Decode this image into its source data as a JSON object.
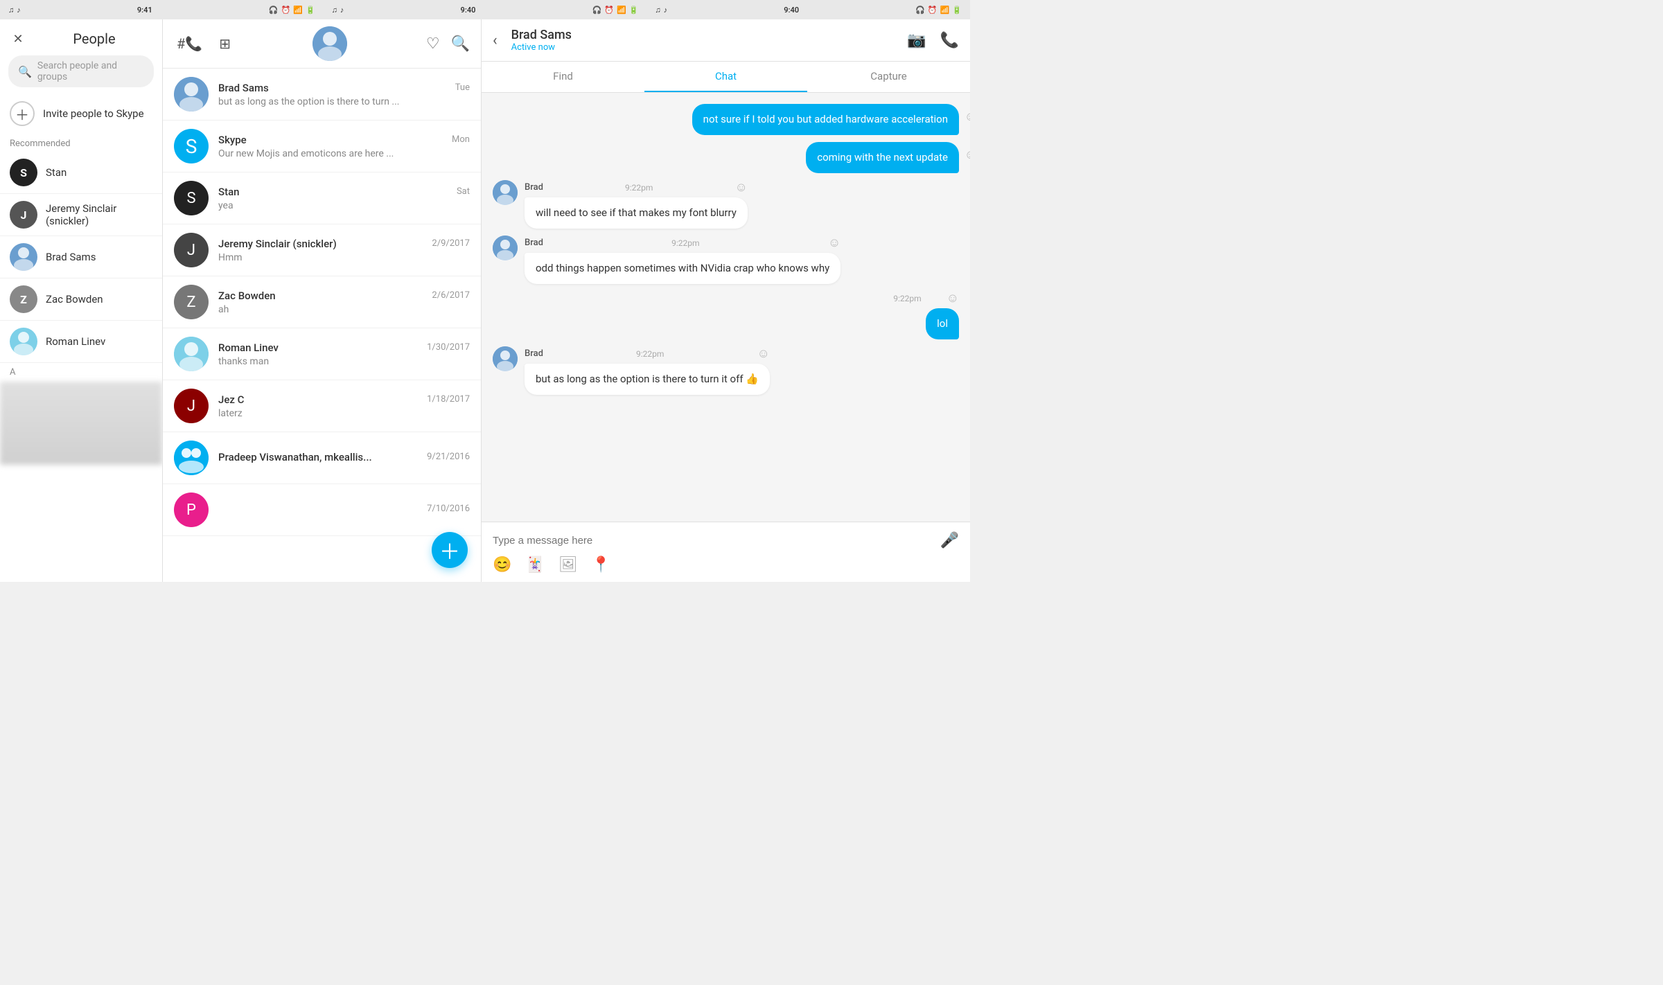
{
  "statusBars": [
    {
      "id": "left",
      "time": "9:41",
      "icons": [
        "spotify",
        "music"
      ]
    },
    {
      "id": "middle",
      "time": "9:40",
      "icons": [
        "spotify",
        "music"
      ]
    },
    {
      "id": "right",
      "time": "9:40",
      "icons": [
        "spotify",
        "music"
      ]
    }
  ],
  "leftPanel": {
    "title": "People",
    "searchPlaceholder": "Search people and groups",
    "inviteLabel": "Invite people to Skype",
    "sectionLabel": "Recommended",
    "contacts": [
      {
        "id": "stan",
        "name": "Stan"
      },
      {
        "id": "jeremy",
        "name": "Jeremy Sinclair (snickler)"
      },
      {
        "id": "brad",
        "name": "Brad Sams"
      },
      {
        "id": "zac",
        "name": "Zac Bowden"
      },
      {
        "id": "roman",
        "name": "Roman Linev"
      }
    ],
    "alphabetSection": "A"
  },
  "middlePanel": {
    "chats": [
      {
        "id": "brad",
        "name": "Brad Sams",
        "date": "Tue",
        "preview": "but as long as the option is there to turn ..."
      },
      {
        "id": "skype",
        "name": "Skype",
        "date": "Mon",
        "preview": "Our new Mojis and emoticons are here ..."
      },
      {
        "id": "stan",
        "name": "Stan",
        "date": "Sat",
        "preview": "yea"
      },
      {
        "id": "jeremy",
        "name": "Jeremy Sinclair (snickler)",
        "date": "2/9/2017",
        "preview": "Hmm"
      },
      {
        "id": "zac",
        "name": "Zac Bowden",
        "date": "2/6/2017",
        "preview": "ah"
      },
      {
        "id": "roman",
        "name": "Roman Linev",
        "date": "1/30/2017",
        "preview": "thanks man"
      },
      {
        "id": "jezc",
        "name": "Jez C",
        "date": "1/18/2017",
        "preview": "laterz"
      },
      {
        "id": "group",
        "name": "Pradeep Viswanathan, mkeallis...",
        "date": "9/21/2016",
        "preview": ""
      },
      {
        "id": "pink",
        "name": "",
        "date": "7/10/2016",
        "preview": ""
      }
    ]
  },
  "rightPanel": {
    "contactName": "Brad Sams",
    "contactStatus": "Active now",
    "tabs": [
      "Find",
      "Chat",
      "Capture"
    ],
    "activeTab": "Chat",
    "messages": [
      {
        "id": "sent1",
        "type": "sent",
        "text": "not sure if I told you but added hardware acceleration",
        "showEmoji": true
      },
      {
        "id": "sent2",
        "type": "sent",
        "text": "coming with the next update",
        "showEmoji": true
      },
      {
        "id": "recv1",
        "type": "received",
        "sender": "Brad",
        "time": "9:22pm",
        "text": "will need to see if that makes my font blurry",
        "showEmoji": true
      },
      {
        "id": "recv2",
        "type": "received",
        "sender": "Brad",
        "time": "9:22pm",
        "text": "odd things happen sometimes with NVidia crap who knows why",
        "showEmoji": true
      },
      {
        "id": "sent3",
        "type": "sent-timed",
        "time": "9:22pm",
        "text": "lol",
        "showEmoji": true
      },
      {
        "id": "recv3",
        "type": "received",
        "sender": "Brad",
        "time": "9:22pm",
        "text": "but as long as the option is there to turn it off 👍",
        "showEmoji": true
      }
    ],
    "inputPlaceholder": "Type a message here"
  }
}
